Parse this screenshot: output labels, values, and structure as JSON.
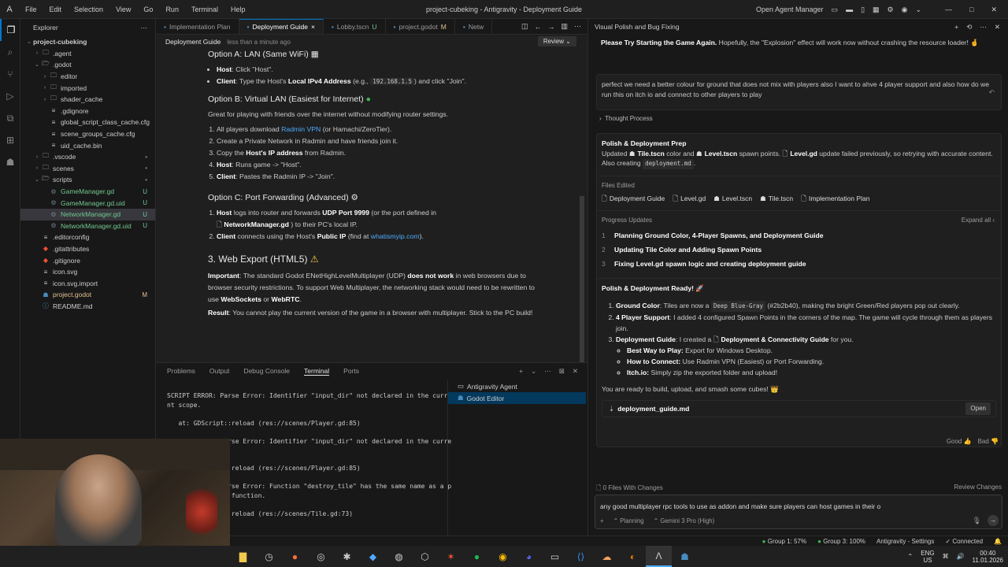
{
  "titlebar": {
    "menu": [
      "File",
      "Edit",
      "Selection",
      "View",
      "Go",
      "Run",
      "Terminal",
      "Help"
    ],
    "title": "project-cubeking - Antigravity - Deployment Guide",
    "open_agent_manager": "Open Agent Manager"
  },
  "explorer": {
    "header": "Explorer",
    "items": [
      {
        "label": "project-cubeking",
        "depth": 0,
        "kind": "root",
        "badge": ""
      },
      {
        "label": ".agent",
        "depth": 1,
        "kind": "folder",
        "badge": ""
      },
      {
        "label": ".godot",
        "depth": 1,
        "kind": "folder-open",
        "badge": ""
      },
      {
        "label": "editor",
        "depth": 2,
        "kind": "folder",
        "badge": ""
      },
      {
        "label": "imported",
        "depth": 2,
        "kind": "folder",
        "badge": ""
      },
      {
        "label": "shader_cache",
        "depth": 2,
        "kind": "folder",
        "badge": ""
      },
      {
        "label": ".gdignore",
        "depth": 2,
        "kind": "file",
        "badge": ""
      },
      {
        "label": "global_script_class_cache.cfg",
        "depth": 2,
        "kind": "file",
        "badge": ""
      },
      {
        "label": "scene_groups_cache.cfg",
        "depth": 2,
        "kind": "file",
        "badge": ""
      },
      {
        "label": "uid_cache.bin",
        "depth": 2,
        "kind": "file",
        "badge": ""
      },
      {
        "label": ".vscode",
        "depth": 1,
        "kind": "folder",
        "badge": "•"
      },
      {
        "label": "scenes",
        "depth": 1,
        "kind": "folder",
        "badge": "•"
      },
      {
        "label": "scripts",
        "depth": 1,
        "kind": "folder-open",
        "badge": "•"
      },
      {
        "label": "GameManager.gd",
        "depth": 2,
        "kind": "gd",
        "badge": "U"
      },
      {
        "label": "GameManager.gd.uid",
        "depth": 2,
        "kind": "gd",
        "badge": "U"
      },
      {
        "label": "NetworkManager.gd",
        "depth": 2,
        "kind": "gd",
        "badge": "U"
      },
      {
        "label": "NetworkManager.gd.uid",
        "depth": 2,
        "kind": "gd",
        "badge": "U"
      },
      {
        "label": ".editorconfig",
        "depth": 1,
        "kind": "file",
        "badge": ""
      },
      {
        "label": ".gitattributes",
        "depth": 1,
        "kind": "git",
        "badge": ""
      },
      {
        "label": ".gitignore",
        "depth": 1,
        "kind": "git",
        "badge": ""
      },
      {
        "label": "icon.svg",
        "depth": 1,
        "kind": "file",
        "badge": ""
      },
      {
        "label": "icon.svg.import",
        "depth": 1,
        "kind": "file",
        "badge": ""
      },
      {
        "label": "project.godot",
        "depth": 1,
        "kind": "godot",
        "badge": "M"
      },
      {
        "label": "README.md",
        "depth": 1,
        "kind": "md",
        "badge": ""
      }
    ]
  },
  "editor": {
    "tabs": [
      {
        "label": "Implementation Plan",
        "mark": "",
        "active": false
      },
      {
        "label": "Deployment Guide",
        "mark": "×",
        "active": true
      },
      {
        "label": "Lobby.tscn",
        "mark": "U",
        "active": false
      },
      {
        "label": "project.godot",
        "mark": "M",
        "active": false
      },
      {
        "label": "Netw",
        "mark": "",
        "active": false
      }
    ],
    "doc_title": "Deployment Guide",
    "doc_time": "less than a minute ago",
    "review_label": "Review",
    "optA_title": "Option A: LAN (Same WiFi)",
    "optA_host_label": "Host",
    "optA_host_text": ": Click \"Host\".",
    "optA_client_label": "Client",
    "optA_client_text1": ": Type the Host's ",
    "optA_client_bold": "Local IPv4 Address",
    "optA_client_text2": " (e.g., ",
    "optA_client_code": "192.168.1.5",
    "optA_client_text3": ") and click \"Join\".",
    "optB_title": "Option B: Virtual LAN (Easiest for Internet)",
    "optB_intro": "Great for playing with friends over the internet without modifying router settings.",
    "optB_s1a": "All players download ",
    "optB_s1link": "Radmin VPN",
    "optB_s1b": " (or Hamachi/ZeroTier).",
    "optB_s2": "Create a Private Network in Radmin and have friends join it.",
    "optB_s3a": "Copy the ",
    "optB_s3b": "Host's IP address",
    "optB_s3c": " from Radmin.",
    "optB_s4a": "Host",
    "optB_s4b": ": Runs game -> \"Host\".",
    "optB_s5a": "Client",
    "optB_s5b": ": Pastes the Radmin IP -> \"Join\".",
    "optC_title": "Option C: Port Forwarding (Advanced)",
    "optC_s1a": "Host",
    "optC_s1b": " logs into router and forwards ",
    "optC_s1c": "UDP Port 9999",
    "optC_s1d": " (or the port defined in",
    "optC_s1e": "NetworkManager.gd",
    "optC_s1f": ") to their PC's local IP.",
    "optC_s2a": "Client",
    "optC_s2b": " connects using the Host's ",
    "optC_s2c": "Public IP",
    "optC_s2d": " (find at ",
    "optC_s2link": "whatismyip.com",
    "optC_s2e": ").",
    "web_title": "3. Web Export (HTML5)",
    "web_imp_label": "Important",
    "web_imp_a": ": The standard Godot ENetHighLevelMultiplayer (UDP) ",
    "web_imp_b": "does not work",
    "web_imp_c": " in web browsers due to browser security restrictions. To support Web Multiplayer, the networking stack would need to be rewritten to use ",
    "web_imp_d": "WebSockets",
    "web_imp_e": " or ",
    "web_imp_f": "WebRTC",
    "web_imp_g": ".",
    "web_res_label": "Result",
    "web_res_text": ": You cannot play the current version of the game in a browser with multiplayer. Stick to the PC build!"
  },
  "panel": {
    "tabs": [
      "Problems",
      "Output",
      "Debug Console",
      "Terminal",
      "Ports"
    ],
    "active_tab": "Terminal",
    "terminal_lines": [
      "SCRIPT ERROR: Parse Error: Identifier \"input_dir\" not declared in the curre",
      "nt scope.",
      "",
      "   at: GDScript::reload (res://scenes/Player.gd:85)",
      "",
      "SCRIPT ERROR: Parse Error: Identifier \"input_dir\" not declared in the curre",
      "",
      "",
      "   at: GDScript::reload (res://scenes/Player.gd:85)",
      "",
      "SCRIPT ERROR: Parse Error: Function \"destroy_tile\" has the same name as a p",
      "revious declared function.",
      "",
      "   at: GDScript::reload (res://scenes/Tile.gd:73)"
    ],
    "terminals": [
      "Antigravity Agent",
      "Godot Editor"
    ]
  },
  "agent": {
    "header": "Visual Polish and Bug Fixing",
    "prev_bold": "Please Try Starting the Game Again.",
    "prev_text": " Hopefully, the \"Explosion\" effect will work now without crashing the resource loader! 🤞",
    "user_msg": "perfect we need a better colour for ground that does not mix with players also I want to ahve 4 player support and also how do we run this on itch io and connect to other players to play",
    "thought": "Thought Process",
    "prep_title": "Polish & Deployment Prep",
    "prep_a": "Updated ",
    "prep_f1": "Tile.tscn",
    "prep_b": " color and ",
    "prep_f2": "Level.tscn",
    "prep_c": " spawn points. ",
    "prep_f3": "Level.gd",
    "prep_d": " update failed previously, so retrying with accurate content. Also creating ",
    "prep_code": "deployment.md",
    "prep_e": ".",
    "files_edited_label": "Files Edited",
    "files_edited": [
      "Deployment Guide",
      "Level.gd",
      "Level.tscn",
      "Tile.tscn",
      "Implementation Plan"
    ],
    "progress_label": "Progress Updates",
    "expand_all": "Expand all",
    "progress": [
      {
        "n": "1",
        "text": "Planning Ground Color, 4-Player Spawns, and Deployment Guide"
      },
      {
        "n": "2",
        "text": "Updating Tile Color and Adding Spawn Points"
      },
      {
        "n": "3",
        "text": "Fixing Level.gd spawn logic and creating deployment guide"
      }
    ],
    "ready_title": "Polish & Deployment Ready! 🚀",
    "r1_label": "Ground Color",
    "r1_a": ": Tiles are now a ",
    "r1_code": "Deep Blue-Gray",
    "r1_b": " (#2b2b40), making the bright Green/Red players pop out clearly.",
    "r2_label": "4 Player Support",
    "r2_text": ": I added 4 configured Spawn Points in the corners of the map. The game will cycle through them as players join.",
    "r3_label": "Deployment Guide",
    "r3_a": ": I created a ",
    "r3_file": "Deployment & Connectivity Guide",
    "r3_b": " for you.",
    "sub1_label": "Best Way to Play:",
    "sub1_text": " Export for Windows Desktop.",
    "sub2_label": "How to Connect:",
    "sub2_text": " Use Radmin VPN (Easiest) or Port Forwarding.",
    "sub3_label": "Itch.io:",
    "sub3_text": " Simply zip the exported folder and upload!",
    "closing": "You are ready to build, upload, and smash some cubes! 👑",
    "artifact_name": "deployment_guide.md",
    "open_label": "Open",
    "good_label": "Good",
    "bad_label": "Bad",
    "files_changes": "0 Files With Changes",
    "review_changes": "Review Changes",
    "input_text": "any good multiplayer rpc tools to use as addon and make sure players can host games in their o",
    "mode_label": "Planning",
    "model_label": "Gemini 3 Pro (High)"
  },
  "statusbar": {
    "group1": "Group 1: 57%",
    "group3": "Group 3: 100%",
    "settings": "Antigravity - Settings",
    "connected": "Connected"
  },
  "taskbar": {
    "lang1": "ENG",
    "lang2": "US",
    "time": "00:40",
    "date": "11.01.2026"
  },
  "colors": {
    "accent": "#0078d4",
    "untracked": "#73c991",
    "modified": "#e2c08d",
    "link": "#4daafc"
  }
}
